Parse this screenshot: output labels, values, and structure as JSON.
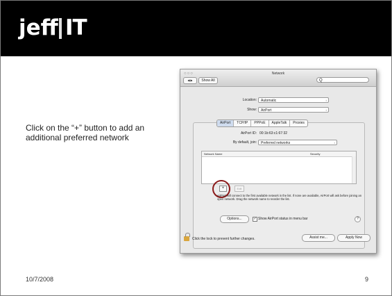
{
  "slide": {
    "logo_jeff": "jeff",
    "logo_it": "IT",
    "instruction": "Click on the “+” button to add an additional preferred network",
    "date": "10/7/2008",
    "page_number": "9"
  },
  "window": {
    "title": "Network",
    "lights": "○○○",
    "nav_back_forward": "◀ ▶",
    "show_all": "Show All",
    "search_icon": "magnifier-icon",
    "search_glyph": "Q",
    "location_label": "Location:",
    "location_value": "Automatic",
    "show_label": "Show:",
    "show_value": "AirPort",
    "tabs": [
      "AirPort",
      "TCP/IP",
      "PPPoE",
      "AppleTalk",
      "Proxies"
    ],
    "airport_id_label": "AirPort ID:",
    "airport_id_value": "00:1b:63:c1:67:32",
    "join_label": "By default, join:",
    "join_value": "Preferred networks",
    "col_network_name": "Network Name",
    "col_security": "Security",
    "plus_button": "+",
    "edit_button": "Edit",
    "info_text": "AirPort will connect to the first available network in the list. If none are available, AirPort will ask before joining an open network. Drag the network name to reorder the list.",
    "options_button": "Options...",
    "checkmark": "✓",
    "show_status_label": "Show AirPort status in menu bar",
    "help_button": "?",
    "lock_text": "Click the lock to prevent further changes.",
    "assist_button": "Assist me...",
    "apply_button": "Apply Now",
    "popup_arrow": "↕"
  }
}
